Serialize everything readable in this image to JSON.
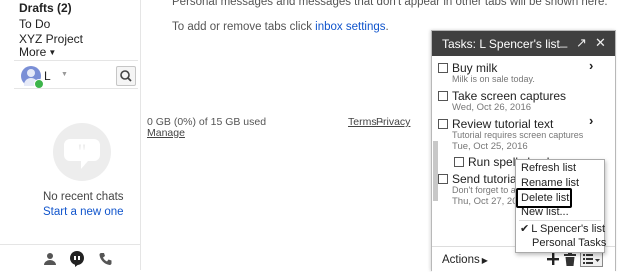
{
  "sidebar": {
    "items": [
      {
        "label": "Drafts (2)",
        "bold": true
      },
      {
        "label": "To Do"
      },
      {
        "label": "XYZ Project"
      },
      {
        "label": "More"
      }
    ],
    "user_initial": "L",
    "no_chats_text": "No recent chats",
    "start_chat_link": "Start a new one"
  },
  "main": {
    "top_message": "Personal messages and messages that don't appear in other tabs will be shown here.",
    "tabs_prefix": "To add or remove tabs click ",
    "tabs_link": "inbox settings",
    "tabs_suffix": ".",
    "storage_text": "0 GB (0%) of 15 GB used",
    "manage_link": "Manage",
    "terms_link": "Terms",
    "separator": "-",
    "privacy_link": "Privacy"
  },
  "tasks": {
    "title": "Tasks: L Spencer's list",
    "items": [
      {
        "title": "Buy milk",
        "note": "Milk is on sale today."
      },
      {
        "title": "Take screen captures",
        "date": "Wed, Oct 26, 2016"
      },
      {
        "title": "Review tutorial text",
        "note": "Tutorial requires screen captures",
        "date": "Tue, Oct 25, 2016"
      },
      {
        "title": "Run spell check"
      },
      {
        "title": "Send tutorial to",
        "note": "Don't forget to add",
        "date": "Thu, Oct 27, 2016"
      }
    ],
    "actions_label": "Actions"
  },
  "menu": {
    "items": [
      "Refresh list",
      "Rename list",
      "Delete list",
      "New list...",
      "L Spencer's list",
      "Personal Tasks"
    ],
    "checked_index": 4
  }
}
